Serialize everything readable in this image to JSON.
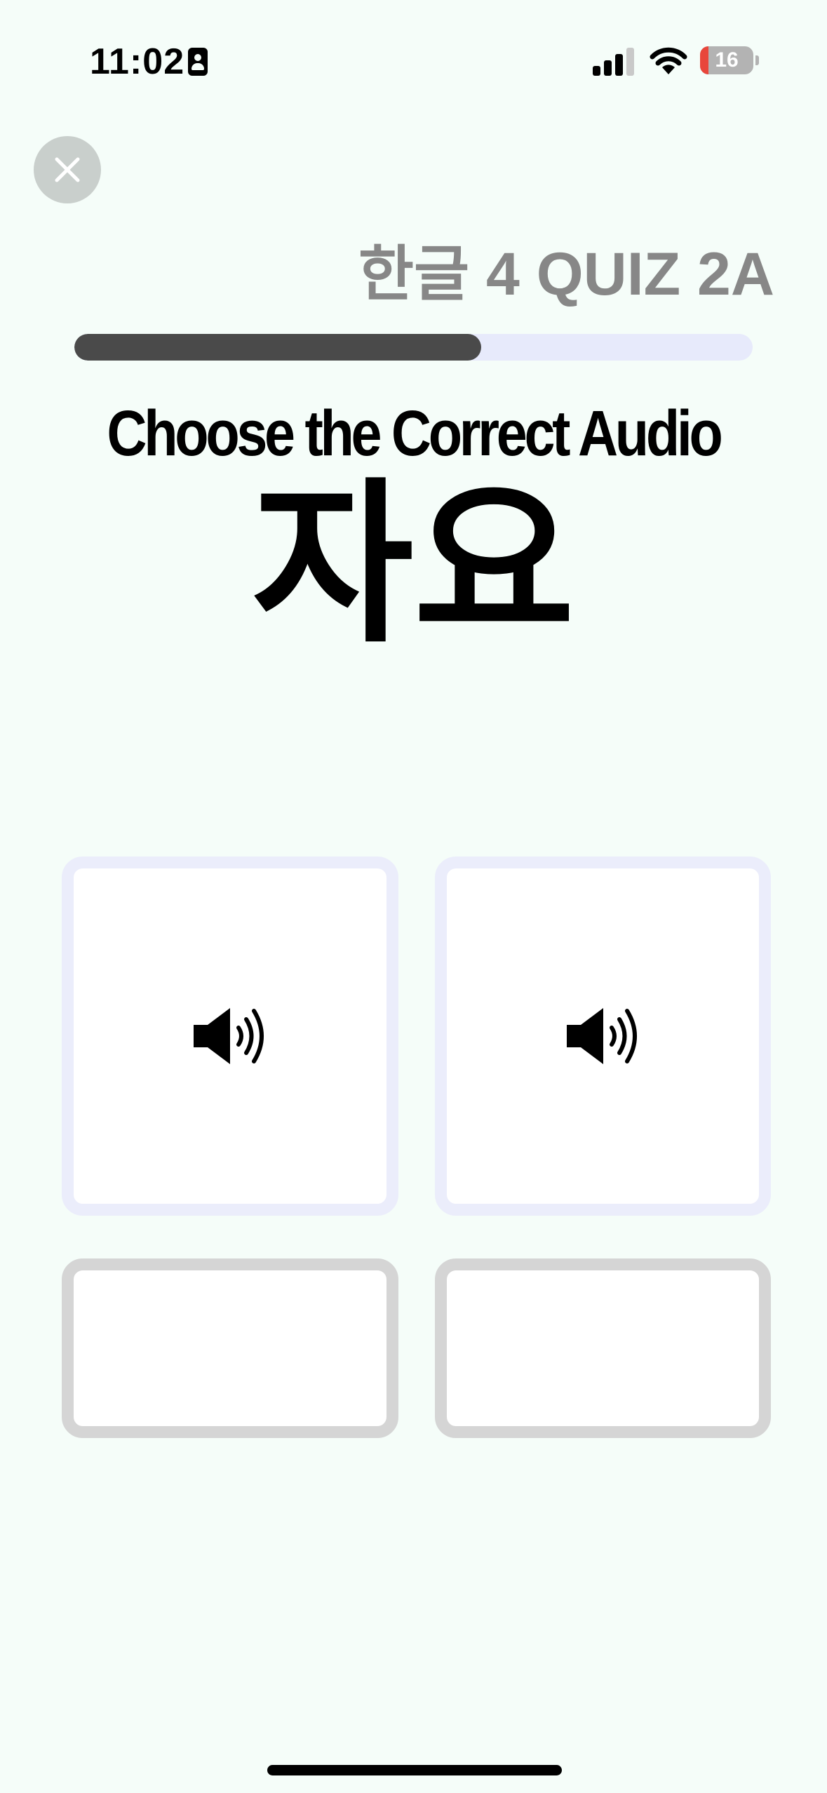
{
  "status_bar": {
    "time": "11:02",
    "battery_percent": "16",
    "battery_level": 0.16,
    "icons": [
      "contact-card-icon",
      "cellular-signal-icon",
      "wifi-icon",
      "battery-icon"
    ]
  },
  "header": {
    "close_icon": "close-icon",
    "quiz_title": "한글 4 QUIZ 2A"
  },
  "progress": {
    "fraction": 0.6
  },
  "question": {
    "prompt": "Choose the Correct Audio",
    "target_word": "자요"
  },
  "answers": [
    {
      "icon": "speaker-icon",
      "state": "available"
    },
    {
      "icon": "speaker-icon",
      "state": "available"
    },
    {
      "icon": "",
      "state": "empty"
    },
    {
      "icon": "",
      "state": "empty"
    }
  ],
  "colors": {
    "background": "#f5fdf9",
    "progress_fill": "#4a4a4a",
    "progress_track": "#e7eafb",
    "card_border_active": "#ebedfb",
    "card_border_empty": "#d5d5d5",
    "title_gray": "#878787",
    "battery_low": "#e8463b"
  }
}
